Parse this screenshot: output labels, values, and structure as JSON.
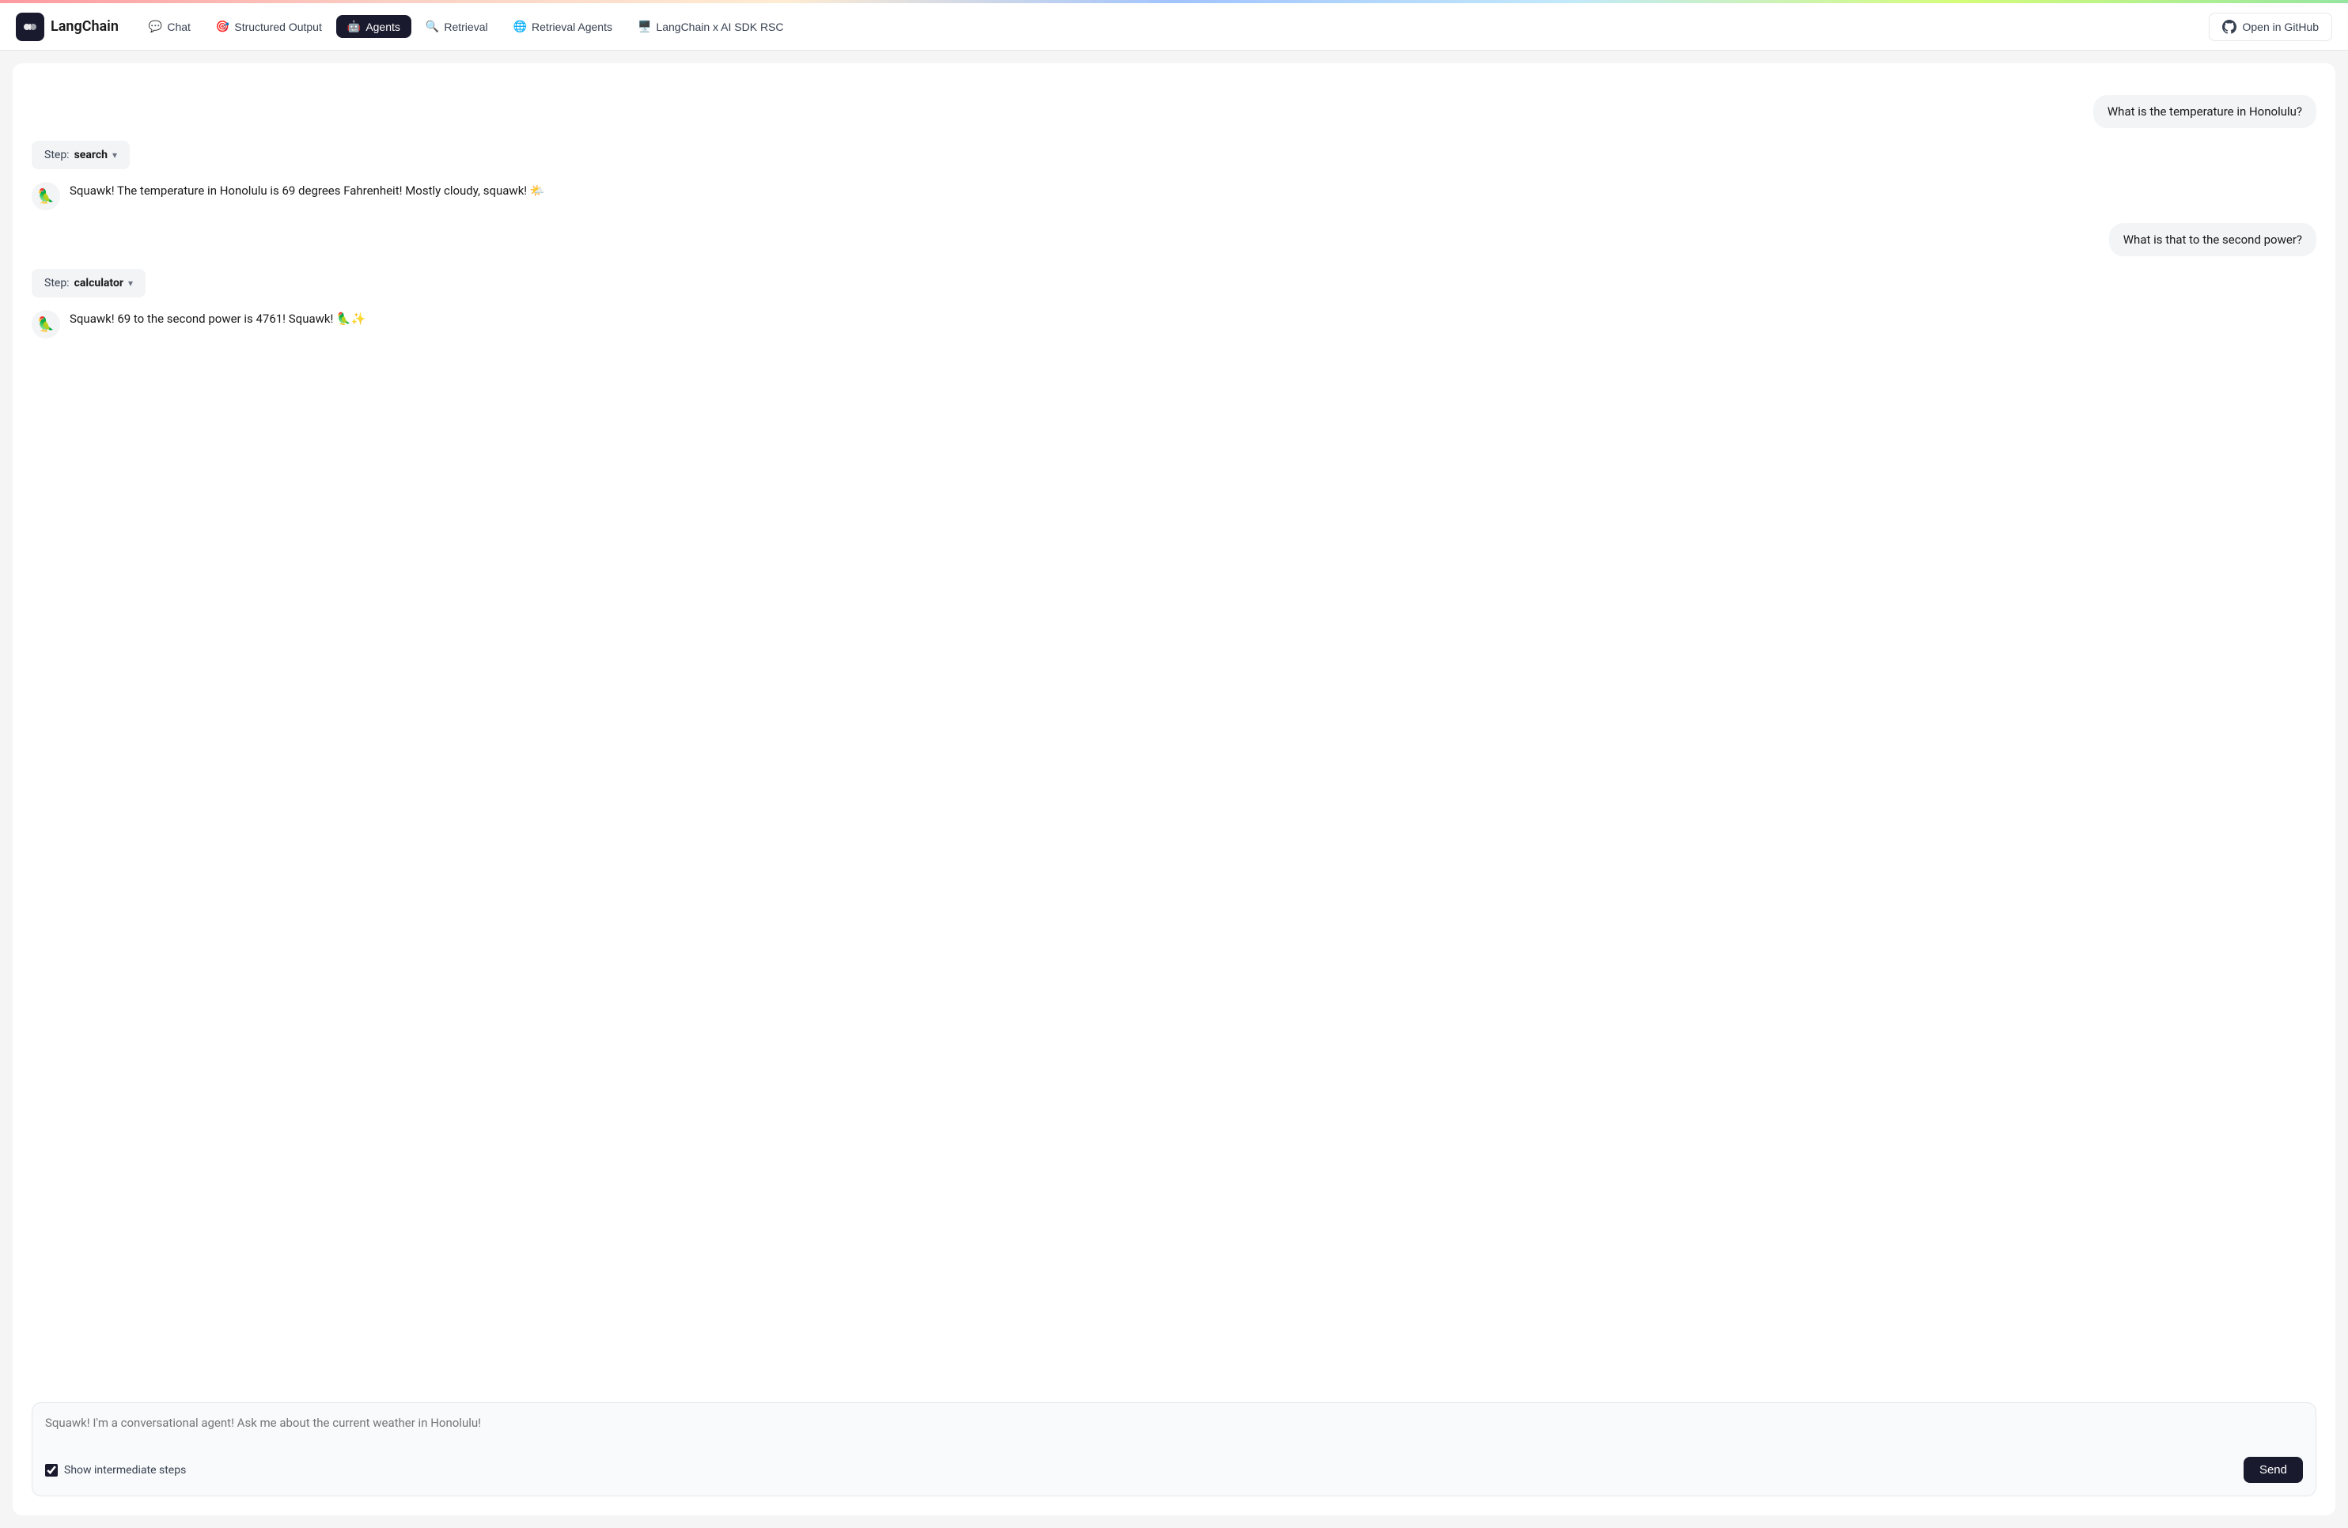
{
  "header": {
    "logo_text": "LangChain",
    "logo_icon": "🔗",
    "github_label": "Open in GitHub"
  },
  "nav": {
    "tabs": [
      {
        "id": "chat",
        "label": "Chat",
        "emoji": "💬",
        "active": false
      },
      {
        "id": "structured-output",
        "label": "Structured Output",
        "emoji": "🎯",
        "active": false
      },
      {
        "id": "agents",
        "label": "Agents",
        "emoji": "🤖",
        "active": true
      },
      {
        "id": "retrieval",
        "label": "Retrieval",
        "emoji": "🔍",
        "active": false
      },
      {
        "id": "retrieval-agents",
        "label": "Retrieval Agents",
        "emoji": "🌐",
        "active": false
      },
      {
        "id": "langchain-ai-sdk",
        "label": "LangChain x AI SDK RSC",
        "emoji": "🖥️",
        "active": false
      }
    ]
  },
  "chat": {
    "messages": [
      {
        "type": "user",
        "text": "What is the temperature in Honolulu?"
      },
      {
        "type": "step",
        "label": "Step:",
        "name": "search",
        "chevron": "▾"
      },
      {
        "type": "agent",
        "avatar": "🦜",
        "text": "Squawk! The temperature in Honolulu is 69 degrees Fahrenheit! Mostly cloudy, squawk! 🌤️"
      },
      {
        "type": "user",
        "text": "What is that to the second power?"
      },
      {
        "type": "step",
        "label": "Step:",
        "name": "calculator",
        "chevron": "▾"
      },
      {
        "type": "agent",
        "avatar": "🦜",
        "text": "Squawk! 69 to the second power is 4761! Squawk! 🦜✨"
      }
    ],
    "input_placeholder": "Squawk! I'm a conversational agent! Ask me about the current weather in Honolulu!",
    "checkbox_label": "Show intermediate steps",
    "send_label": "Send"
  }
}
